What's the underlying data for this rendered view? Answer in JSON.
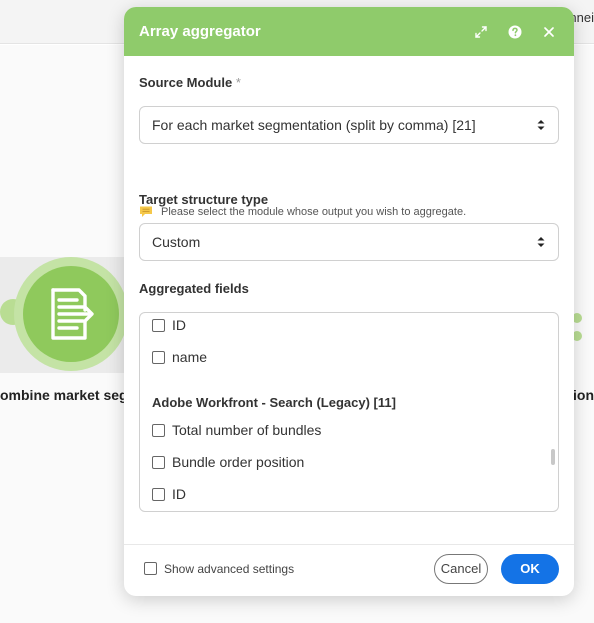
{
  "background": {
    "topbar_text": "nnei",
    "module_label": "ombine market segm",
    "right_label": "ion"
  },
  "dialog": {
    "title": "Array aggregator",
    "header_icons": [
      "expand-icon",
      "help-icon",
      "close-icon"
    ],
    "source_module": {
      "label": "Source Module",
      "required_mark": "*",
      "value": "For each market segmentation (split by comma) [21]",
      "hint": "Please select the module whose output you wish to aggregate."
    },
    "target_structure": {
      "label": "Target structure type",
      "value": "Custom"
    },
    "aggregated_fields": {
      "label": "Aggregated fields",
      "top_items": [
        "ID",
        "name"
      ],
      "group_title": "Adobe Workfront - Search (Legacy) [11]",
      "group_items": [
        "Total number of bundles",
        "Bundle order position",
        "ID"
      ]
    },
    "footer": {
      "advanced_label": "Show advanced settings",
      "cancel_label": "Cancel",
      "ok_label": "OK"
    }
  },
  "colors": {
    "header_green": "#8fcb6b",
    "ok_blue": "#1473e6",
    "module_green": "#8fc95c"
  }
}
